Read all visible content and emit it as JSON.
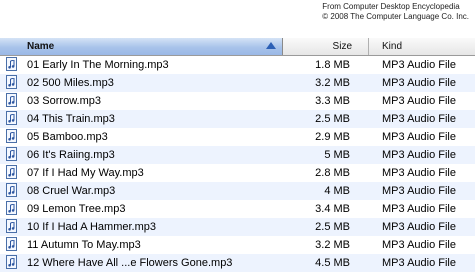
{
  "attribution": {
    "line1": "From Computer Desktop Encyclopedia",
    "line2": "© 2008 The Computer Language Co. Inc."
  },
  "columns": {
    "name": "Name",
    "size": "Size",
    "kind": "Kind"
  },
  "files": [
    {
      "name": "01 Early In The Morning.mp3",
      "size": "1.8 MB",
      "kind": "MP3 Audio File"
    },
    {
      "name": "02 500 Miles.mp3",
      "size": "3.2 MB",
      "kind": "MP3 Audio File"
    },
    {
      "name": "03 Sorrow.mp3",
      "size": "3.3 MB",
      "kind": "MP3 Audio File"
    },
    {
      "name": "04 This Train.mp3",
      "size": "2.5 MB",
      "kind": "MP3 Audio File"
    },
    {
      "name": "05 Bamboo.mp3",
      "size": "2.9 MB",
      "kind": "MP3 Audio File"
    },
    {
      "name": "06 It's Raiing.mp3",
      "size": "5 MB",
      "kind": "MP3 Audio File"
    },
    {
      "name": "07 If I Had My Way.mp3",
      "size": "2.8 MB",
      "kind": "MP3 Audio File"
    },
    {
      "name": "08 Cruel War.mp3",
      "size": "4 MB",
      "kind": "MP3 Audio File"
    },
    {
      "name": "09 Lemon Tree.mp3",
      "size": "3.4 MB",
      "kind": "MP3 Audio File"
    },
    {
      "name": "10 If I Had A Hammer.mp3",
      "size": "2.5 MB",
      "kind": "MP3 Audio File"
    },
    {
      "name": "11 Autumn To May.mp3",
      "size": "3.2 MB",
      "kind": "MP3 Audio File"
    },
    {
      "name": "12 Where Have All ...e Flowers Gone.mp3",
      "size": "4.5 MB",
      "kind": "MP3 Audio File"
    }
  ],
  "icons": {
    "file": "music-file-icon",
    "sort": "sort-ascending-icon"
  },
  "colors": {
    "selected_header": "#a8c3ea",
    "alt_row": "#edf3fe",
    "sort_arrow": "#2b5fb5"
  }
}
